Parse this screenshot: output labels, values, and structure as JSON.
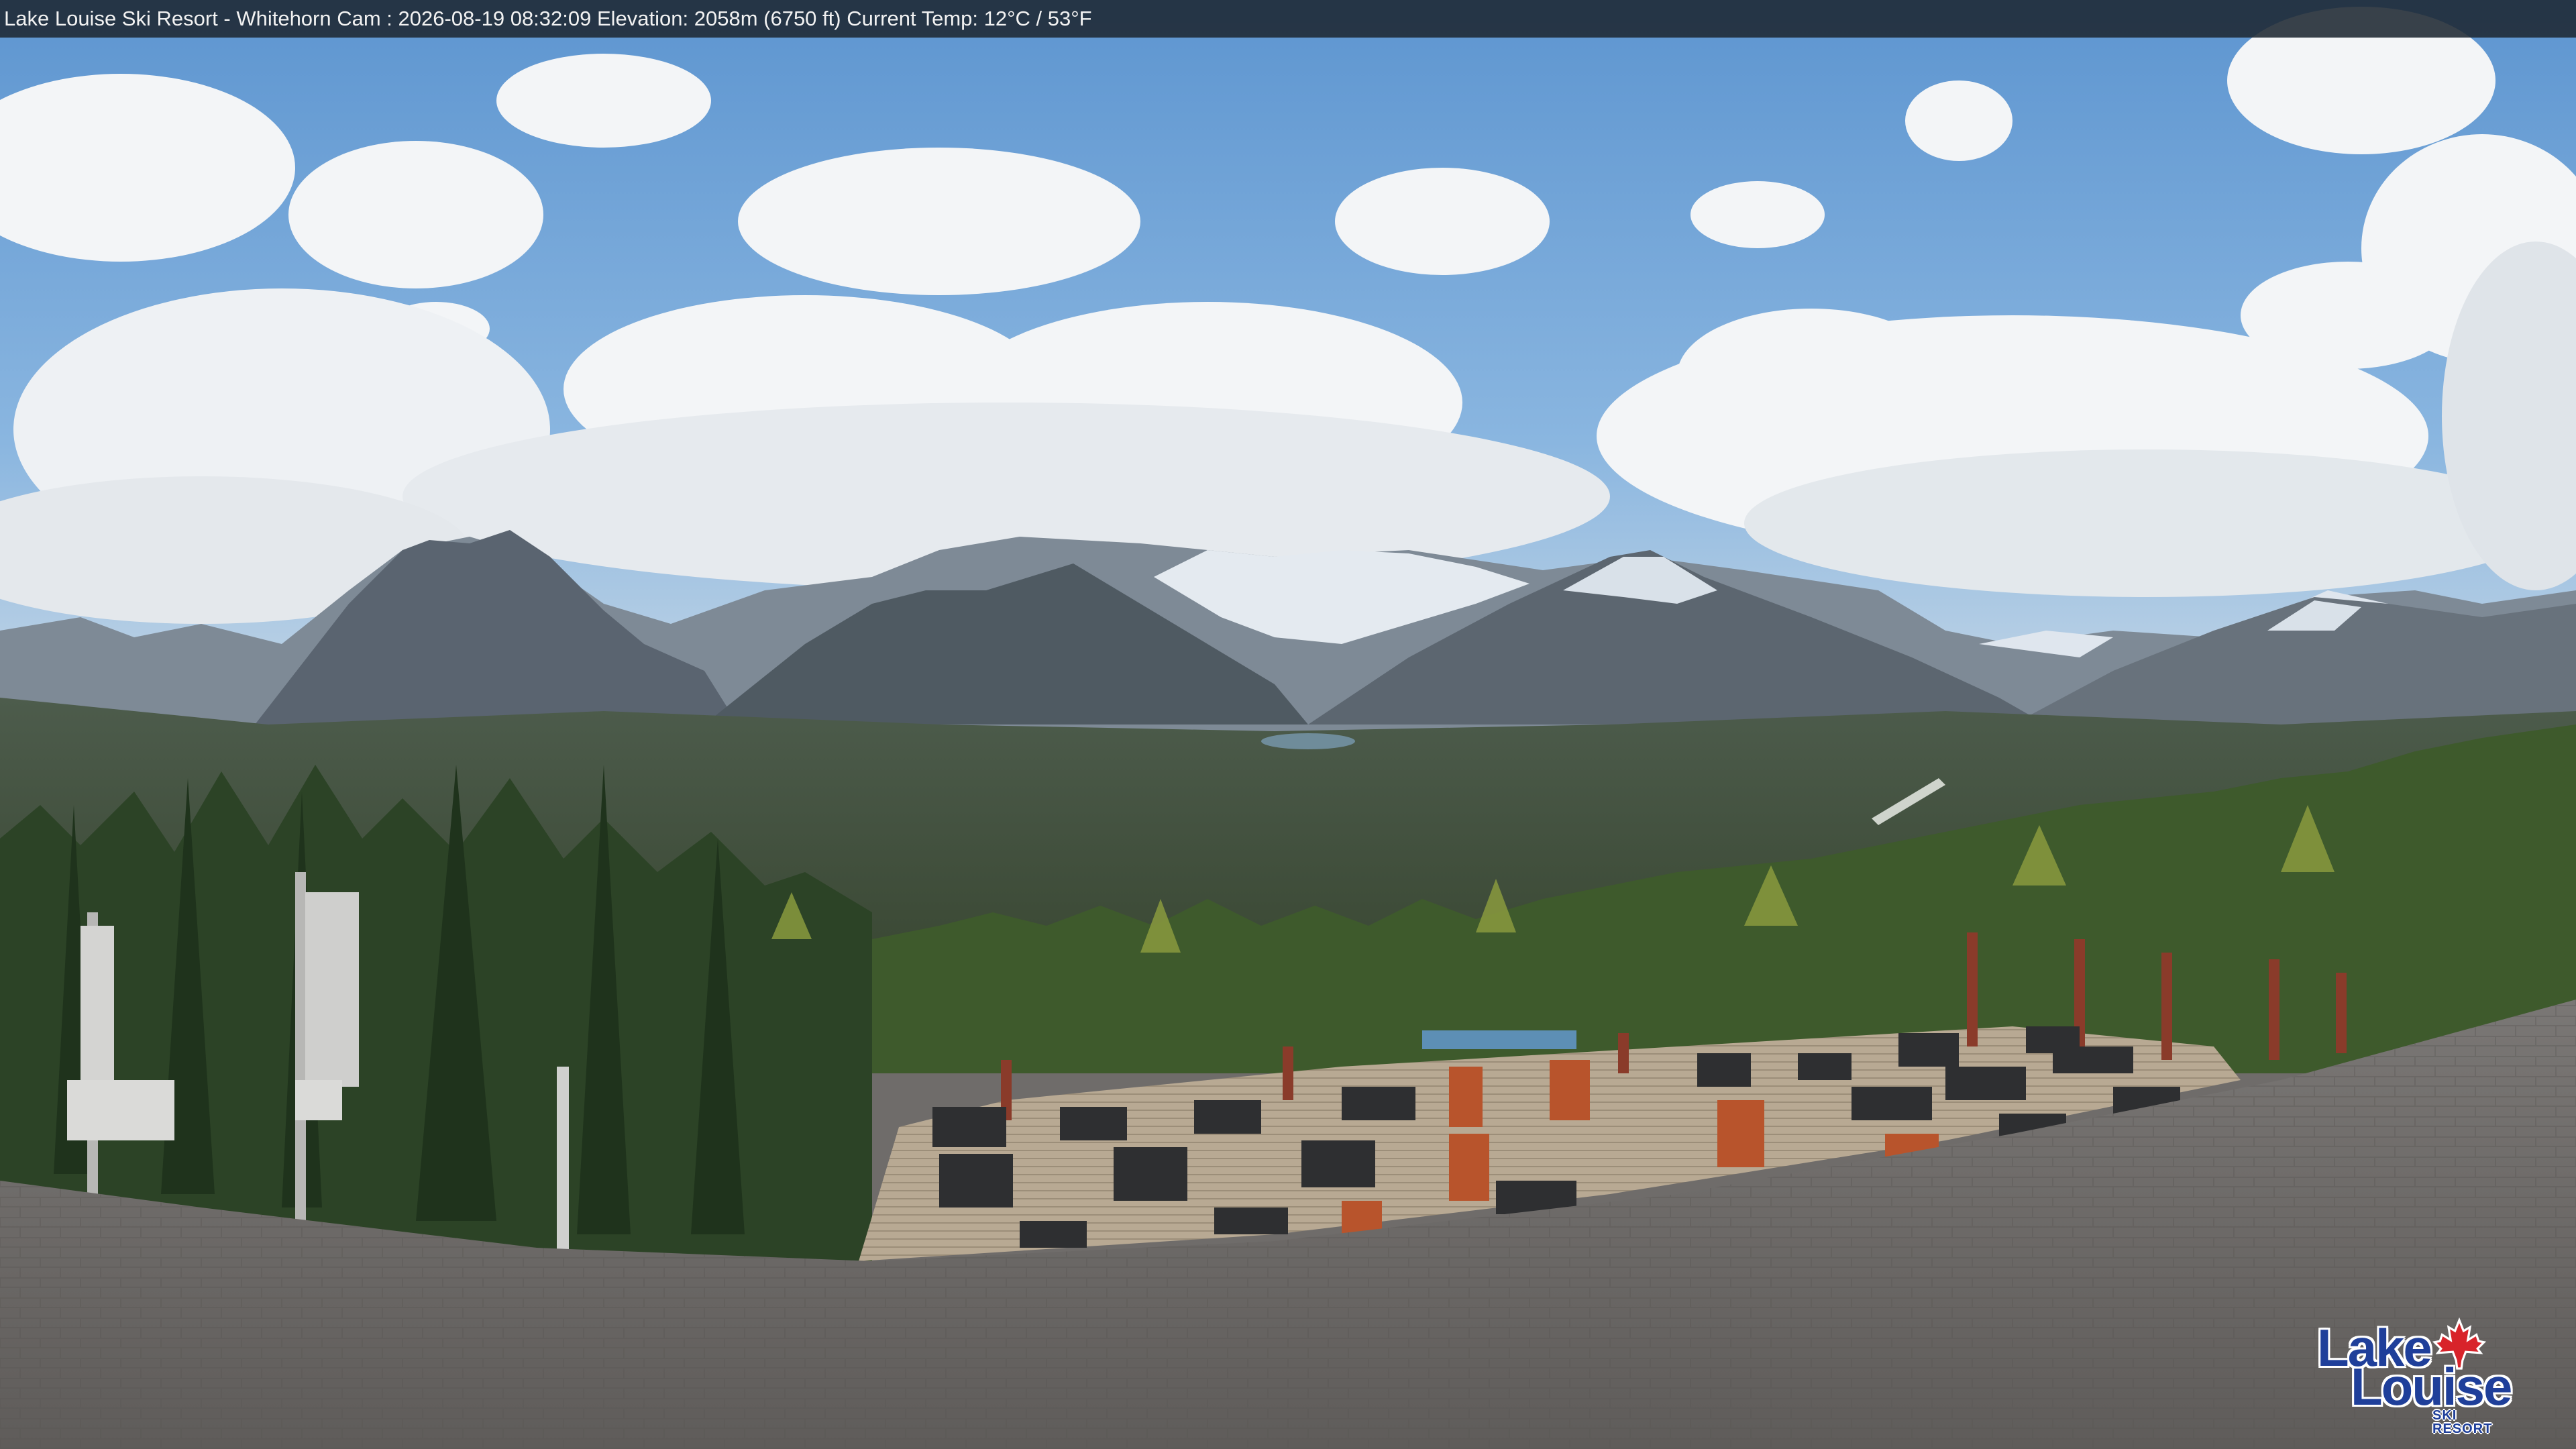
{
  "overlay": {
    "caption": "Lake Louise Ski Resort - Whitehorn Cam : 2026-08-19 08:32:09  Elevation: 2058m (6750 ft) Current Temp: 12°C / 53°F"
  },
  "logo": {
    "line1": "Lake",
    "line2": "Louise",
    "sub": "SKI RESORT",
    "icon": "maple-leaf-icon"
  },
  "colors": {
    "sky": "#6fa3d8",
    "cloud": "#f4f6f8",
    "mountain": "#5b6670",
    "snow": "#e6ecf2",
    "forest": "#2f4a2a",
    "deck": "#b9aa94",
    "roof": "#6f6c6a",
    "logo_blue": "#1f3f9a",
    "maple_red": "#d8232a"
  }
}
